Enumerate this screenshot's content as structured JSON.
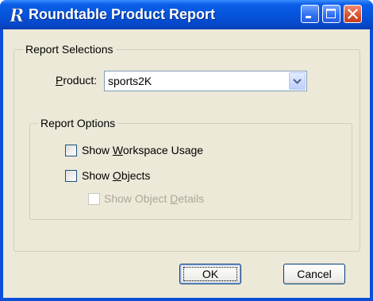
{
  "window": {
    "title": "Roundtable Product Report",
    "app_logo_letter": "R",
    "controls": [
      "minimize",
      "maximize",
      "close"
    ]
  },
  "report_selections": {
    "legend": "Report Selections",
    "product_label_prefix": "",
    "product_label_mnemonic": "P",
    "product_label_rest": "roduct:",
    "product_value": "sports2K"
  },
  "report_options": {
    "legend": "Report Options",
    "show_workspace_usage": {
      "pre": "Show ",
      "mnemonic": "W",
      "post": "orkspace Usage",
      "checked": false,
      "enabled": true
    },
    "show_objects": {
      "pre": "Show ",
      "mnemonic": "O",
      "post": "bjects",
      "checked": false,
      "enabled": true
    },
    "show_object_details": {
      "pre": "Show Object ",
      "mnemonic": "D",
      "post": "etails",
      "checked": false,
      "enabled": false
    }
  },
  "buttons": {
    "ok_label": "OK",
    "cancel_label": "Cancel"
  },
  "colors": {
    "title_bar": "#0553da",
    "dialog_face": "#ece9d8",
    "close_button": "#d8512f",
    "disabled_text": "#aca899"
  }
}
